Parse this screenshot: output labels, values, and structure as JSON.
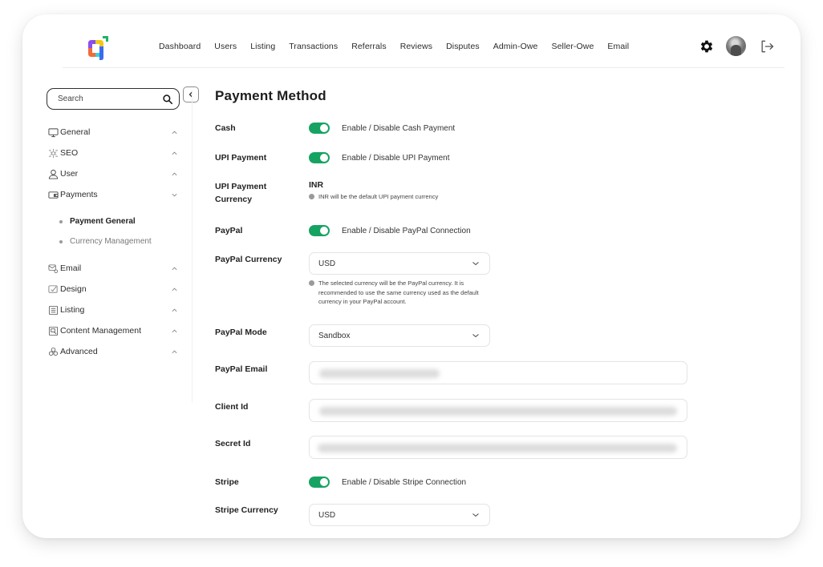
{
  "nav": {
    "items": [
      "Dashboard",
      "Users",
      "Listing",
      "Transactions",
      "Referrals",
      "Reviews",
      "Disputes",
      "Admin-Owe",
      "Seller-Owe",
      "Email"
    ],
    "icons": {
      "settings": "gear-icon",
      "profile": "avatar",
      "logout": "logout-icon"
    }
  },
  "sidebar": {
    "search_placeholder": "Search",
    "menu": [
      {
        "label": "General",
        "icon": "monitor-icon",
        "expanded": false
      },
      {
        "label": "SEO",
        "icon": "network-icon",
        "expanded": false
      },
      {
        "label": "User",
        "icon": "user-icon",
        "expanded": false
      },
      {
        "label": "Payments",
        "icon": "wallet-icon",
        "expanded": true,
        "children": [
          {
            "label": "Payment General",
            "active": true
          },
          {
            "label": "Currency Management",
            "active": false
          }
        ]
      },
      {
        "label": "Email",
        "icon": "email-settings-icon",
        "expanded": false
      },
      {
        "label": "Design",
        "icon": "design-icon",
        "expanded": false
      },
      {
        "label": "Listing",
        "icon": "list-icon",
        "expanded": false
      },
      {
        "label": "Content Management",
        "icon": "content-icon",
        "expanded": false
      },
      {
        "label": "Advanced",
        "icon": "advanced-icon",
        "expanded": false
      }
    ]
  },
  "main": {
    "title": "Payment Method",
    "cash": {
      "label": "Cash",
      "enabled": true,
      "toggle_text": "Enable / Disable Cash Payment"
    },
    "upi": {
      "label": "UPI Payment",
      "enabled": true,
      "toggle_text": "Enable / Disable UPI Payment"
    },
    "upi_currency": {
      "label": "UPI Payment Currency",
      "value": "INR",
      "hint": "INR will be the default UPI payment currency"
    },
    "paypal": {
      "label": "PayPal",
      "enabled": true,
      "toggle_text": "Enable / Disable PayPal Connection"
    },
    "paypal_currency": {
      "label": "PayPal Currency",
      "value": "USD",
      "hint": "The selected currency will be the PayPal currency. It is recommended to use the same currency used as the default currency in your PayPal account."
    },
    "paypal_mode": {
      "label": "PayPal Mode",
      "value": "Sandbox"
    },
    "paypal_email": {
      "label": "PayPal Email",
      "value": "(blurred)"
    },
    "client_id": {
      "label": "Client Id",
      "value": "(blurred)"
    },
    "secret_id": {
      "label": "Secret Id",
      "value": "(blurred)"
    },
    "stripe": {
      "label": "Stripe",
      "enabled": true,
      "toggle_text": "Enable / Disable Stripe Connection"
    },
    "stripe_currency": {
      "label": "Stripe Currency",
      "value": "USD"
    }
  },
  "colors": {
    "toggle_on": "#16a362",
    "text": "#1f1f1f",
    "border": "#e4e4e4"
  }
}
